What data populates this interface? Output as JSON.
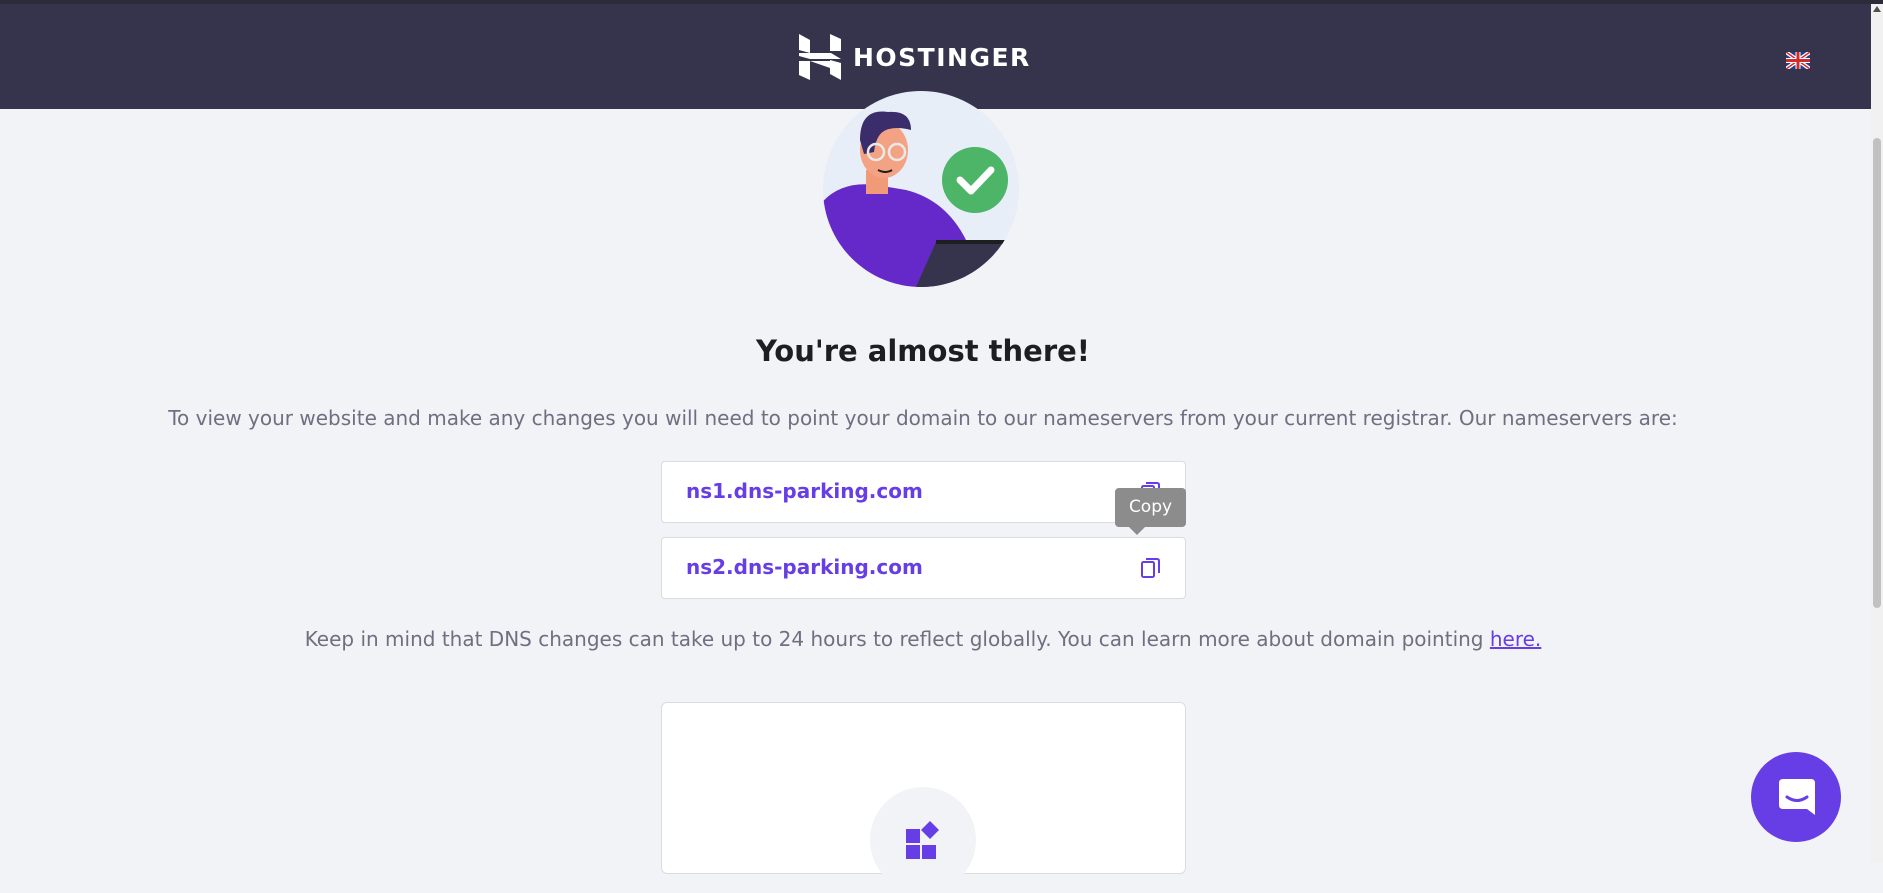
{
  "header": {
    "brand_name": "HOSTINGER",
    "logo_icon": "hostinger-logo-icon",
    "language_icon": "uk-flag-icon"
  },
  "colors": {
    "header_bg": "#36344d",
    "page_bg": "#f2f3f6",
    "accent": "#673de6",
    "success": "#4cb567",
    "text_dark": "#1d1e20",
    "text_muted": "#6d7081"
  },
  "main": {
    "illustration_icon": "person-with-checkmark-illustration",
    "title": "You're almost there!",
    "description": "To view your website and make any changes you will need to point your domain to our nameservers from your current registrar. Our nameservers are:",
    "nameservers": [
      {
        "value": "ns1.dns-parking.com",
        "copy_icon": "copy-icon"
      },
      {
        "value": "ns2.dns-parking.com",
        "copy_icon": "copy-icon"
      }
    ],
    "tooltip": "Copy",
    "note_text": "Keep in mind that DNS changes can take up to 24 hours to reflect globally. You can learn more about domain pointing ",
    "note_link": "here.",
    "card_icon": "widgets-icon"
  },
  "chat": {
    "icon": "chat-icon"
  }
}
